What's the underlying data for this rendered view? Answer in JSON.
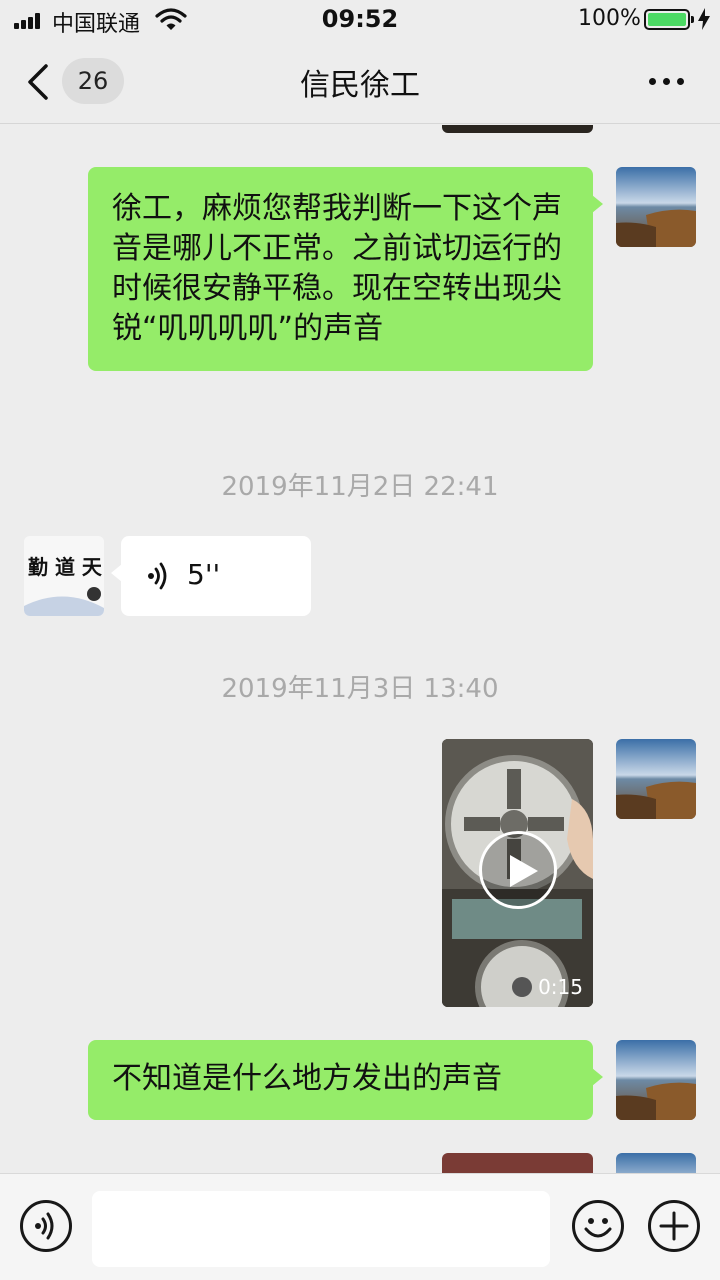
{
  "status_bar": {
    "carrier": "中国联通",
    "time": "09:52",
    "battery_percent": "100%",
    "battery_level": 1.0
  },
  "nav": {
    "unread_count": "26",
    "title": "信民徐工"
  },
  "messages": [
    {
      "type": "text",
      "sender": "me",
      "text": "徐工，麻烦您帮我判断一下这个声音是哪儿不正常。之前试切运行的时候很安静平稳。现在空转出现尖锐“叽叽叽叽”的声音"
    },
    {
      "type": "timestamp",
      "text": "2019年11月2日 22:41"
    },
    {
      "type": "voice",
      "sender": "other",
      "duration": "5''"
    },
    {
      "type": "timestamp",
      "text": "2019年11月3日 13:40"
    },
    {
      "type": "video",
      "sender": "me",
      "duration": "0:15"
    },
    {
      "type": "text",
      "sender": "me",
      "text": "不知道是什么地方发出的声音"
    }
  ],
  "input": {
    "placeholder": ""
  },
  "colors": {
    "background": "#ededed",
    "bubble_me": "#95ec69",
    "bubble_other": "#ffffff",
    "timestamp": "#a9a9a9",
    "battery_fill": "#4cd964"
  },
  "icons": [
    "signal-icon",
    "wifi-icon",
    "battery-icon",
    "charging-bolt-icon",
    "back-chevron-icon",
    "more-icon",
    "voice-wave-icon",
    "play-icon",
    "voice-input-icon",
    "emoji-icon",
    "plus-icon"
  ]
}
